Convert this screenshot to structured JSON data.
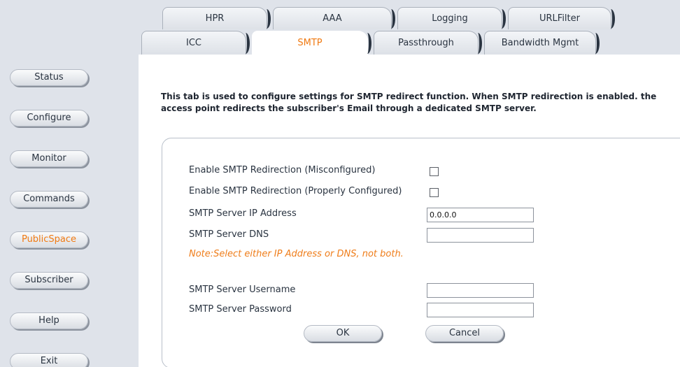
{
  "sidebar": {
    "items": [
      {
        "label": "Status"
      },
      {
        "label": "Configure"
      },
      {
        "label": "Monitor"
      },
      {
        "label": "Commands"
      },
      {
        "label": "PublicSpace"
      },
      {
        "label": "Subscriber"
      },
      {
        "label": "Help"
      },
      {
        "label": "Exit"
      }
    ],
    "active": "PublicSpace"
  },
  "tabs": {
    "row1": [
      {
        "label": "HPR"
      },
      {
        "label": "AAA"
      },
      {
        "label": "Logging"
      },
      {
        "label": "URLFilter"
      }
    ],
    "row2": [
      {
        "label": "ICC"
      },
      {
        "label": "SMTP"
      },
      {
        "label": "Passthrough"
      },
      {
        "label": "Bandwidth Mgmt"
      }
    ],
    "active": "SMTP"
  },
  "main": {
    "intro_line1": "This tab is used to configure settings for SMTP redirect function. When SMTP redirection is enabled. the",
    "intro_line2": "access point redirects the subscriber's Email through a dedicated SMTP server.",
    "fields": {
      "enable_misconfigured_label": "Enable SMTP Redirection (Misconfigured)",
      "enable_misconfigured_checked": false,
      "enable_proper_label": "Enable SMTP Redirection (Properly Configured)",
      "enable_proper_checked": false,
      "server_ip_label": "SMTP Server IP Address",
      "server_ip_value": "0.0.0.0",
      "server_dns_label": "SMTP Server DNS",
      "server_dns_value": "",
      "note": "Note:Select either IP Address or DNS, not both.",
      "username_label": "SMTP Server Username",
      "username_value": "",
      "password_label": "SMTP Server Password",
      "password_value": ""
    },
    "buttons": {
      "ok": "OK",
      "cancel": "Cancel"
    }
  },
  "colors": {
    "sidebar_bg": "#dfe3ea",
    "accent": "#f07a12",
    "note": "#ef7d1a",
    "text": "#2a3441"
  }
}
